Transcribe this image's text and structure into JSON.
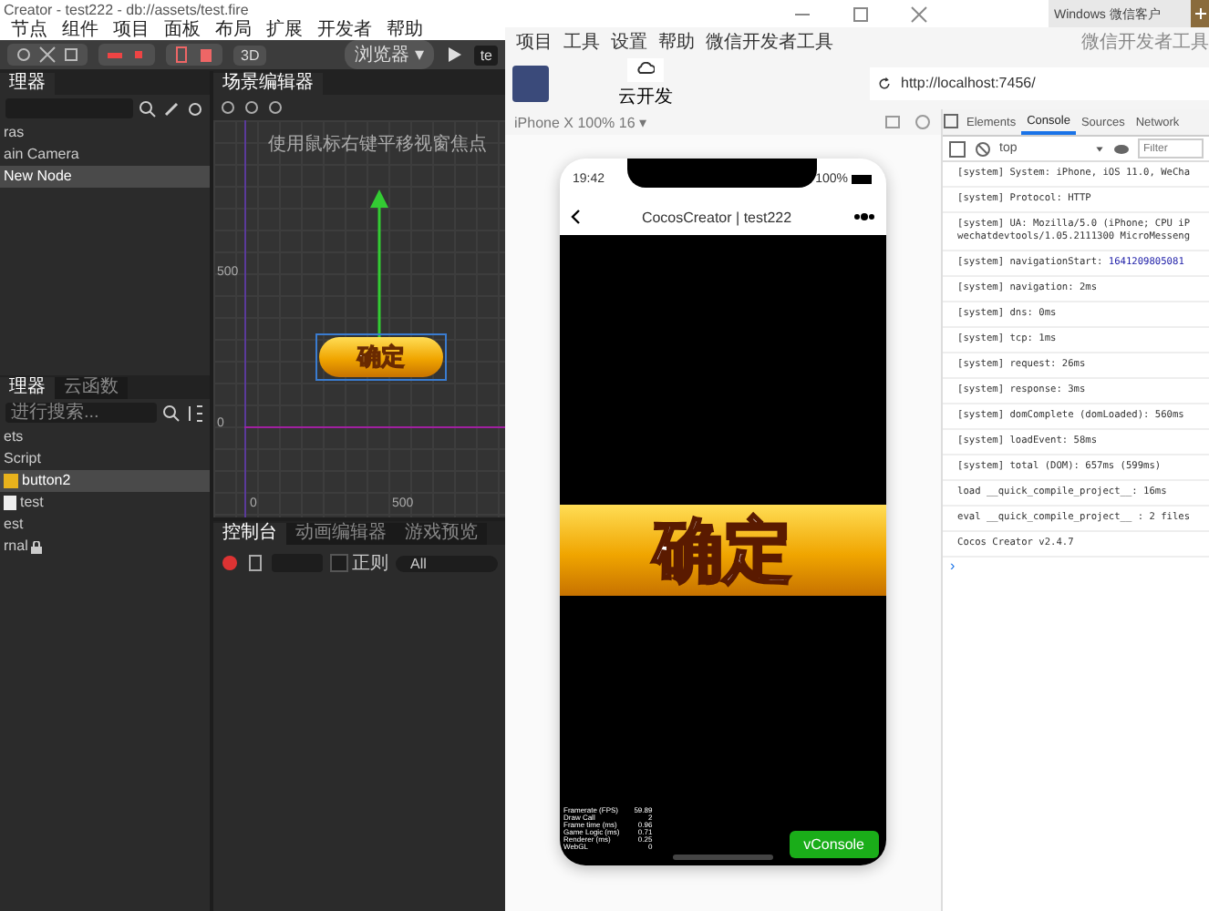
{
  "editor": {
    "title": "Creator - test222 - db://assets/test.fire",
    "menu": [
      "节点",
      "组件",
      "项目",
      "面板",
      "布局",
      "扩展",
      "开发者",
      "帮助"
    ],
    "toolbar": {
      "mode_button": "3D",
      "platform": "浏览器 ▾",
      "device_field": "te"
    },
    "hierarchy": {
      "tab": "理器",
      "items": [
        {
          "label": "ras",
          "selected": false
        },
        {
          "label": "ain Camera",
          "selected": false
        },
        {
          "label": "New Node",
          "selected": true
        }
      ]
    },
    "assets": {
      "tabs": [
        {
          "label": "理器",
          "selected": true
        },
        {
          "label": "云函数",
          "selected": false
        }
      ],
      "search": {
        "placeholder": "进行搜索..."
      },
      "items": [
        {
          "label": "ets",
          "kind": "folder",
          "selected": false
        },
        {
          "label": "Script",
          "kind": "folder",
          "selected": false
        },
        {
          "label": "button2",
          "kind": "image",
          "selected": true
        },
        {
          "label": "test",
          "kind": "file",
          "selected": false
        },
        {
          "label": "est",
          "kind": "folder",
          "selected": false
        },
        {
          "label": "rnal",
          "kind": "locked",
          "selected": false
        }
      ]
    },
    "scene": {
      "tab": "场景编辑器",
      "hint": "使用鼠标右键平移视窗焦点",
      "y_labels": [
        "500",
        "0"
      ],
      "x_labels": [
        "0",
        "500"
      ],
      "node_label": "确定"
    },
    "console": {
      "tabs": [
        {
          "label": "控制台",
          "selected": true
        },
        {
          "label": "动画编辑器",
          "selected": false
        },
        {
          "label": "游戏预览",
          "selected": false
        }
      ],
      "regex_label": "正则",
      "regex_checked": false,
      "level": "All"
    }
  },
  "devtool": {
    "browser_tab": "Windows 微信客户",
    "menu": [
      "项目",
      "工具",
      "设置",
      "帮助",
      "微信开发者工具"
    ],
    "app_name": "微信开发者工具",
    "cloud_button": "云开发",
    "url": "http://localhost:7456/",
    "device": "iPhone X 100% 16 ▾",
    "phone": {
      "time": "19:42",
      "battery": "100%",
      "title": "CocosCreator | test222",
      "game_button": "确定",
      "stats": [
        {
          "name": "Framerate (FPS)",
          "value": "59.89"
        },
        {
          "name": "Draw Call",
          "value": "2"
        },
        {
          "name": "Frame time (ms)",
          "value": "0.96"
        },
        {
          "name": "Game Logic (ms)",
          "value": "0.71"
        },
        {
          "name": "Renderer (ms)",
          "value": "0.25"
        },
        {
          "name": "WebGL",
          "value": "0"
        }
      ],
      "vconsole": "vConsole"
    },
    "tabs": [
      {
        "label": "Elements",
        "selected": false
      },
      {
        "label": "Console",
        "selected": true
      },
      {
        "label": "Sources",
        "selected": false
      },
      {
        "label": "Network",
        "selected": false
      }
    ],
    "context": "top",
    "filter": {
      "placeholder": "Filter"
    },
    "logs": [
      {
        "text": "[system] System: iPhone, iOS 11.0, WeCha"
      },
      {
        "text": "[system] Protocol: HTTP"
      },
      {
        "text": "[system] UA: Mozilla/5.0 (iPhone; CPU iP",
        "continuation": "wechatdevtools/1.05.2111300 MicroMesseng"
      },
      {
        "text": "[system] navigationStart: ",
        "number": "1641209805081"
      },
      {
        "text": "[system] navigation: 2ms"
      },
      {
        "text": "[system] dns: 0ms"
      },
      {
        "text": "[system] tcp: 1ms"
      },
      {
        "text": "[system] request: 26ms"
      },
      {
        "text": "[system] response: 3ms"
      },
      {
        "text": "[system] domComplete (domLoaded): 560ms"
      },
      {
        "text": "[system] loadEvent: 58ms"
      },
      {
        "text": "[system] total (DOM): 657ms (599ms)"
      },
      {
        "text": "load __quick_compile_project__: 16ms"
      },
      {
        "text": "eval __quick_compile_project__ : 2 files"
      },
      {
        "text": "Cocos Creator v2.4.7"
      }
    ],
    "prompt": "›"
  }
}
